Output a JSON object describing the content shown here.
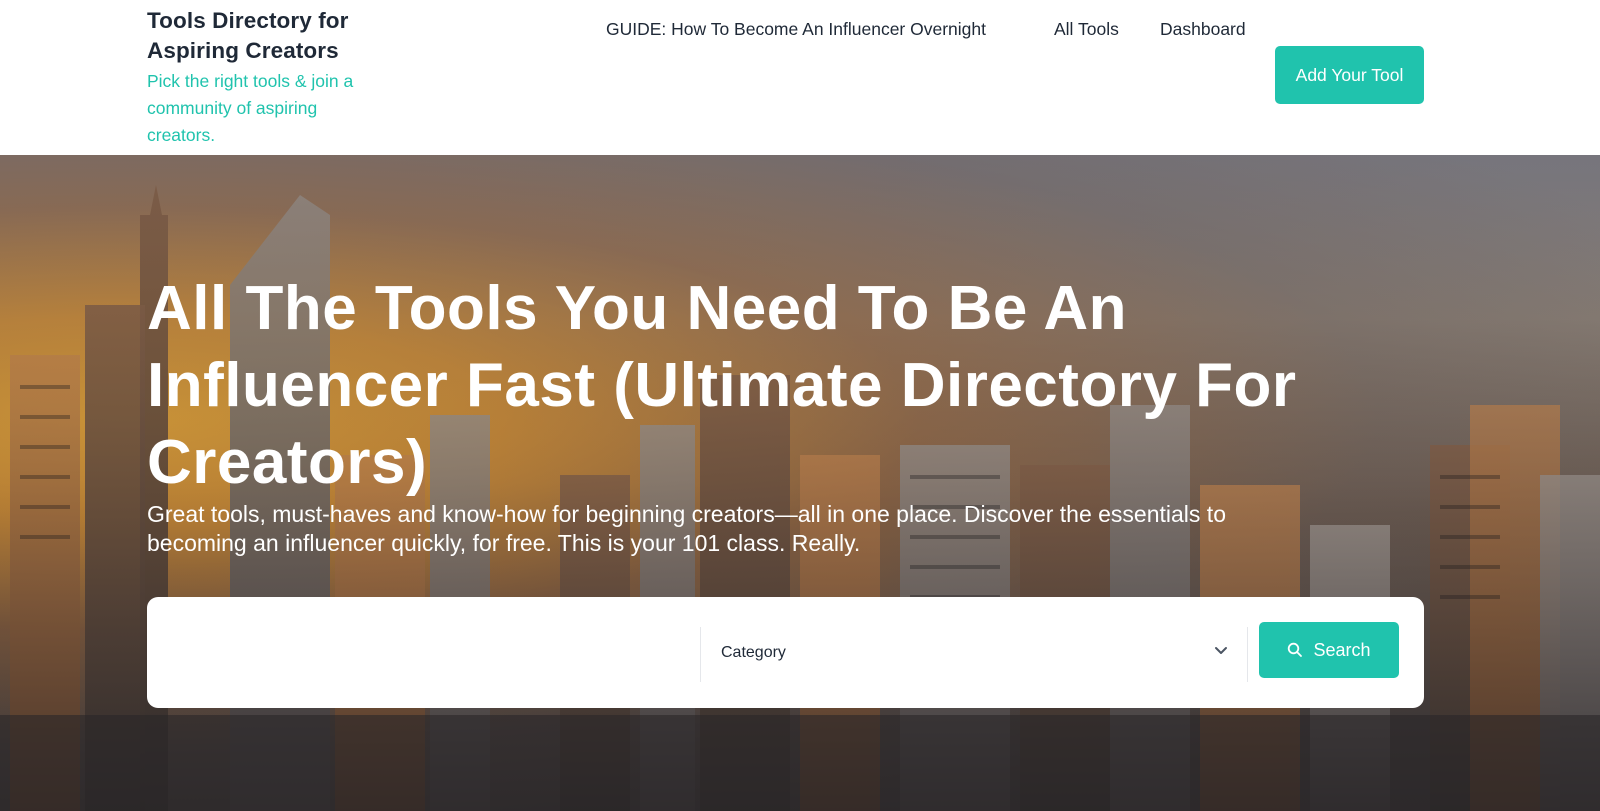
{
  "header": {
    "brand_title": "Tools Directory for Aspiring Creators",
    "brand_tagline": "Pick the right tools & join a community of aspiring creators.",
    "nav": {
      "guide": "GUIDE: How To Become An Influencer Overnight",
      "all_tools": "All Tools",
      "dashboard": "Dashboard",
      "add_tool": "Add Your Tool"
    }
  },
  "hero": {
    "title": "All The Tools You Need To Be An Influencer Fast (Ultimate Directory For Creators)",
    "subtitle": "Great tools, must-haves and know-how for beginning creators—all in one place. Discover the essentials to becoming an influencer quickly, for free. This is your 101 class. Really.",
    "search": {
      "keyword_value": "",
      "category_selected": "Category",
      "button_label": "Search"
    }
  },
  "colors": {
    "accent": "#20c3ad",
    "text_dark": "#1f2937",
    "white": "#ffffff"
  },
  "icons": {
    "search": "search-icon",
    "chevron": "chevron-down-icon"
  }
}
